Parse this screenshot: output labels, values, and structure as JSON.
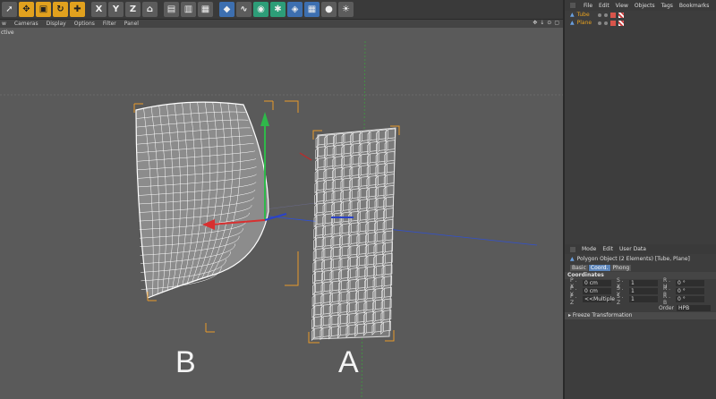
{
  "toolbar": {
    "tools": [
      {
        "name": "select-arrow-icon",
        "glyph": "➚",
        "style": "gray"
      },
      {
        "name": "move-tool-icon",
        "glyph": "✥",
        "style": "orange"
      },
      {
        "name": "scale-tool-icon",
        "glyph": "▣",
        "style": "orange"
      },
      {
        "name": "rotate-tool-icon",
        "glyph": "↻",
        "style": "orange"
      },
      {
        "name": "add-tool-icon",
        "glyph": "✚",
        "style": "orange"
      },
      {
        "name": "sep",
        "glyph": "",
        "style": "sep"
      },
      {
        "name": "x-axis-icon",
        "glyph": "X",
        "style": "gray"
      },
      {
        "name": "y-axis-icon",
        "glyph": "Y",
        "style": "gray"
      },
      {
        "name": "z-axis-icon",
        "glyph": "Z",
        "style": "gray"
      },
      {
        "name": "coord-system-icon",
        "glyph": "⌂",
        "style": "gray"
      },
      {
        "name": "sep",
        "glyph": "",
        "style": "sep"
      },
      {
        "name": "render-view-icon",
        "glyph": "▤",
        "style": "gray"
      },
      {
        "name": "render-picture-icon",
        "glyph": "▥",
        "style": "gray"
      },
      {
        "name": "render-settings-icon",
        "glyph": "▦",
        "style": "gray"
      },
      {
        "name": "sep",
        "glyph": "",
        "style": "sep"
      },
      {
        "name": "cube-icon",
        "glyph": "◆",
        "style": "blue"
      },
      {
        "name": "spline-icon",
        "glyph": "∿",
        "style": "gray"
      },
      {
        "name": "nurbs-icon",
        "glyph": "◉",
        "style": "teal"
      },
      {
        "name": "array-icon",
        "glyph": "✱",
        "style": "teal"
      },
      {
        "name": "deformer-icon",
        "glyph": "◈",
        "style": "blue"
      },
      {
        "name": "floor-icon",
        "glyph": "▦",
        "style": "blue"
      },
      {
        "name": "camera-icon",
        "glyph": "●",
        "style": "gray"
      },
      {
        "name": "light-icon",
        "glyph": "☀",
        "style": "gray"
      }
    ]
  },
  "viewport_menu": {
    "items": [
      "w",
      "Cameras",
      "Display",
      "Options",
      "Filter",
      "Panel"
    ],
    "perspective_label": "ctive"
  },
  "viewport_labels": {
    "a": "A",
    "b": "B"
  },
  "object_manager": {
    "menu": [
      "File",
      "Edit",
      "View",
      "Objects",
      "Tags",
      "Bookmarks"
    ],
    "objects": [
      {
        "name": "Tube"
      },
      {
        "name": "Plane"
      }
    ]
  },
  "attributes": {
    "menu": [
      "Mode",
      "Edit",
      "User Data"
    ],
    "info": "Polygon Object (2 Elements) [Tube, Plane]",
    "tabs": [
      {
        "label": "Basic",
        "active": false
      },
      {
        "label": "Coord.",
        "active": true
      },
      {
        "label": "Phong",
        "active": false
      }
    ],
    "section_title": "Coordinates",
    "coord_rows": [
      [
        {
          "label": "P . X",
          "value": "0 cm"
        },
        {
          "label": "S . X",
          "value": "1"
        },
        {
          "label": "R . H",
          "value": "0 °"
        }
      ],
      [
        {
          "label": "P . Y",
          "value": "0 cm"
        },
        {
          "label": "S . Y",
          "value": "1"
        },
        {
          "label": "R . P",
          "value": "0 °"
        }
      ],
      [
        {
          "label": "P . Z",
          "value": "<<Multiple"
        },
        {
          "label": "S . Z",
          "value": "1"
        },
        {
          "label": "R . B",
          "value": "0 °"
        }
      ]
    ],
    "order_label": "Order",
    "order_value": "HPB",
    "freeze_label": "▸ Freeze Transformation"
  }
}
